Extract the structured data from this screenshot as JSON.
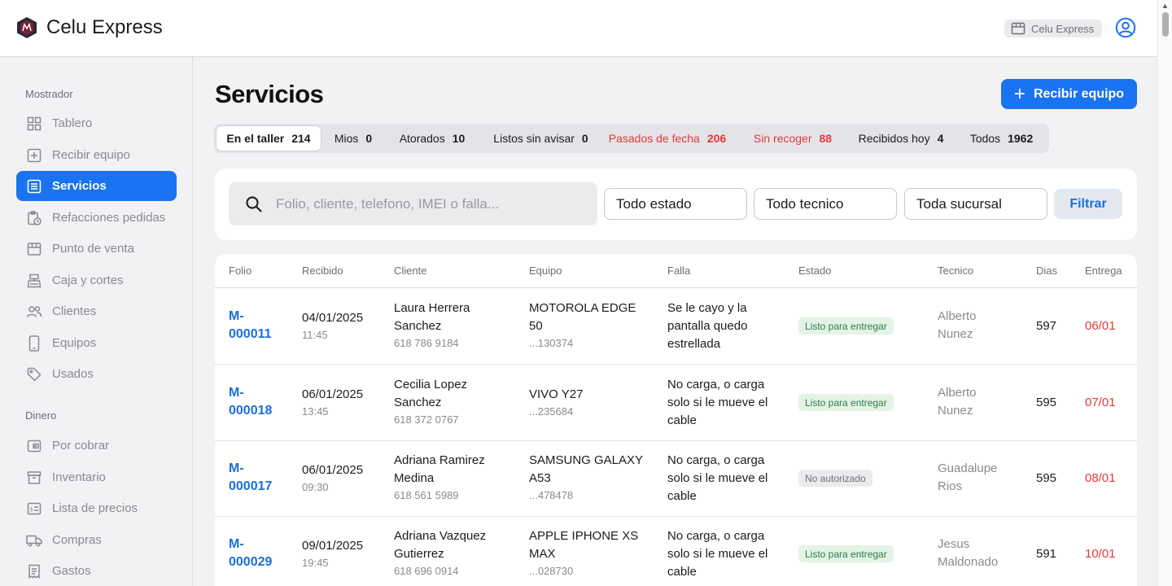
{
  "app": {
    "name": "Celu Express",
    "store_chip": "Celu Express"
  },
  "sidebar": {
    "sections": [
      {
        "title": "Mostrador",
        "items": [
          {
            "label": "Tablero",
            "icon": "grid-icon"
          },
          {
            "label": "Recibir equipo",
            "icon": "plus-square-icon"
          },
          {
            "label": "Servicios",
            "icon": "list-icon",
            "active": true
          },
          {
            "label": "Refacciones pedidas",
            "icon": "clipboard-clock-icon"
          },
          {
            "label": "Punto de venta",
            "icon": "store-icon"
          },
          {
            "label": "Caja y cortes",
            "icon": "cash-register-icon"
          },
          {
            "label": "Clientes",
            "icon": "users-icon"
          },
          {
            "label": "Equipos",
            "icon": "phone-icon"
          },
          {
            "label": "Usados",
            "icon": "tag-icon"
          }
        ]
      },
      {
        "title": "Dinero",
        "items": [
          {
            "label": "Por cobrar",
            "icon": "wallet-icon"
          },
          {
            "label": "Inventario",
            "icon": "archive-icon"
          },
          {
            "label": "Lista de precios",
            "icon": "price-list-icon"
          },
          {
            "label": "Compras",
            "icon": "truck-icon"
          },
          {
            "label": "Gastos",
            "icon": "receipt-icon"
          }
        ]
      }
    ]
  },
  "main": {
    "title": "Servicios",
    "primary_button": "Recibir equipo",
    "tabs": [
      {
        "label": "En el taller",
        "count": "214",
        "active": true
      },
      {
        "label": "Mios",
        "count": "0"
      },
      {
        "label": "Atorados",
        "count": "10"
      },
      {
        "label": "Listos sin avisar",
        "count": "0"
      },
      {
        "label": "Pasados de fecha",
        "count": "206",
        "color": "#e5383b"
      },
      {
        "label": "Sin recoger",
        "count": "88",
        "color": "#e5383b"
      },
      {
        "label": "Recibidos hoy",
        "count": "4"
      },
      {
        "label": "Todos",
        "count": "1962"
      }
    ],
    "search": {
      "placeholder": "Folio, cliente, telefono, IMEI o falla..."
    },
    "filters": {
      "estado": "Todo estado",
      "tecnico": "Todo tecnico",
      "sucursal": "Toda sucursal",
      "button": "Filtrar"
    }
  },
  "table": {
    "columns": [
      "Folio",
      "Recibido",
      "Cliente",
      "Equipo",
      "Falla",
      "Estado",
      "Tecnico",
      "Dias",
      "Entrega"
    ],
    "rows": [
      {
        "folio_a": "M-",
        "folio_b": "000011",
        "fecha": "04/01/2025",
        "hora": "11:45",
        "cliente_a": "Laura Herrera",
        "cliente_b": "Sanchez",
        "telefono": "618 786 9184",
        "equipo_a": "MOTOROLA EDGE",
        "equipo_b": "50",
        "imei": "...130374",
        "falla": [
          "Se le cayo y la",
          "pantalla quedo",
          "estrellada"
        ],
        "estado": "Listo para entregar",
        "estado_tipo": "ok",
        "tecnico_a": "Alberto",
        "tecnico_b": "Nunez",
        "dias": "597",
        "entrega": "06/01"
      },
      {
        "folio_a": "M-",
        "folio_b": "000018",
        "fecha": "06/01/2025",
        "hora": "13:45",
        "cliente_a": "Cecilia Lopez",
        "cliente_b": "Sanchez",
        "telefono": "618 372 0767",
        "equipo_a": "VIVO Y27",
        "equipo_b": "",
        "imei": "...235684",
        "falla": [
          "No carga, o carga",
          "solo si le mueve el",
          "cable"
        ],
        "estado": "Listo para entregar",
        "estado_tipo": "ok",
        "tecnico_a": "Alberto",
        "tecnico_b": "Nunez",
        "dias": "595",
        "entrega": "07/01"
      },
      {
        "folio_a": "M-",
        "folio_b": "000017",
        "fecha": "06/01/2025",
        "hora": "09:30",
        "cliente_a": "Adriana Ramirez",
        "cliente_b": "Medina",
        "telefono": "618 561 5989",
        "equipo_a": "SAMSUNG GALAXY",
        "equipo_b": "A53",
        "imei": "...478478",
        "falla": [
          "No carga, o carga",
          "solo si le mueve el",
          "cable"
        ],
        "estado": "No autorizado",
        "estado_tipo": "no",
        "tecnico_a": "Guadalupe",
        "tecnico_b": "Rios",
        "dias": "595",
        "entrega": "08/01"
      },
      {
        "folio_a": "M-",
        "folio_b": "000029",
        "fecha": "09/01/2025",
        "hora": "19:45",
        "cliente_a": "Adriana Vazquez",
        "cliente_b": "Gutierrez",
        "telefono": "618 696 0914",
        "equipo_a": "APPLE IPHONE XS",
        "equipo_b": "MAX",
        "imei": "...028730",
        "falla": [
          "No carga, o carga",
          "solo si le mueve el",
          "cable"
        ],
        "estado": "Listo para entregar",
        "estado_tipo": "ok",
        "tecnico_a": "Jesus",
        "tecnico_b": "Maldonado",
        "dias": "591",
        "entrega": "10/01"
      }
    ]
  }
}
